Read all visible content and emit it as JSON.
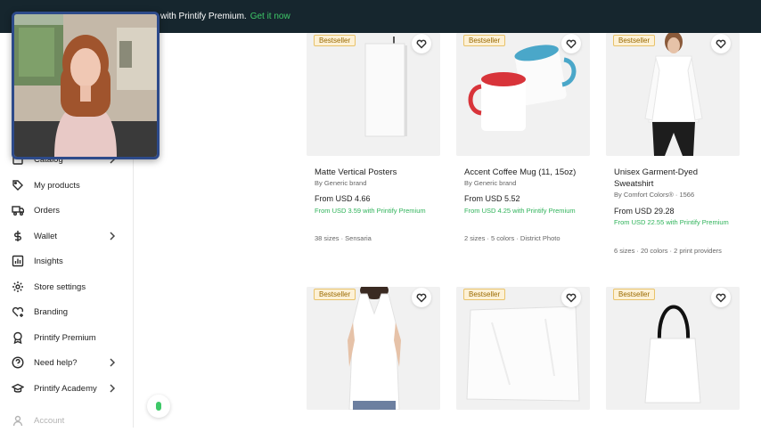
{
  "banner": {
    "text": "with Printify Premium.",
    "link": "Get it now"
  },
  "sidebar": {
    "items": [
      {
        "label": "Catalog",
        "icon": "catalog-icon",
        "chevron": true
      },
      {
        "label": "My products",
        "icon": "tag-icon",
        "chevron": false
      },
      {
        "label": "Orders",
        "icon": "truck-icon",
        "chevron": false
      },
      {
        "label": "Wallet",
        "icon": "dollar-icon",
        "chevron": true
      },
      {
        "label": "Insights",
        "icon": "chart-icon",
        "chevron": false
      },
      {
        "label": "Store settings",
        "icon": "gear-icon",
        "chevron": false
      },
      {
        "label": "Branding",
        "icon": "heart-plus-icon",
        "chevron": false
      },
      {
        "label": "Printify Premium",
        "icon": "medal-icon",
        "chevron": false
      },
      {
        "label": "Need help?",
        "icon": "question-icon",
        "chevron": true
      },
      {
        "label": "Printify Academy",
        "icon": "graduation-cap-icon",
        "chevron": true
      },
      {
        "label": "Account",
        "icon": "user-icon",
        "chevron": false
      }
    ]
  },
  "products": [
    {
      "badge": "Bestseller",
      "name": "Matte Vertical Posters",
      "brand": "By Generic brand",
      "price": "From USD 4.66",
      "premium": "From USD 3.59 with Printify Premium",
      "meta": "38 sizes · Sensaria"
    },
    {
      "badge": "Bestseller",
      "name": "Accent Coffee Mug (11, 15oz)",
      "brand": "By Generic brand",
      "price": "From USD 5.52",
      "premium": "From USD 4.25 with Printify Premium",
      "meta": "2 sizes · 5 colors · District Photo"
    },
    {
      "badge": "Bestseller",
      "name": "Unisex Garment-Dyed Sweatshirt",
      "brand": "By Comfort Colors® · 1566",
      "price": "From USD 29.28",
      "premium": "From USD 22.55 with Printify Premium",
      "meta": "6 sizes · 20 colors · 2 print providers"
    },
    {
      "badge": "Bestseller"
    },
    {
      "badge": "Bestseller"
    },
    {
      "badge": "Bestseller"
    }
  ],
  "colors": {
    "banner_bg": "#16262e",
    "accent_green": "#3ec868",
    "premium_green": "#2fb35a",
    "badge_bg": "#fdf1d6"
  }
}
